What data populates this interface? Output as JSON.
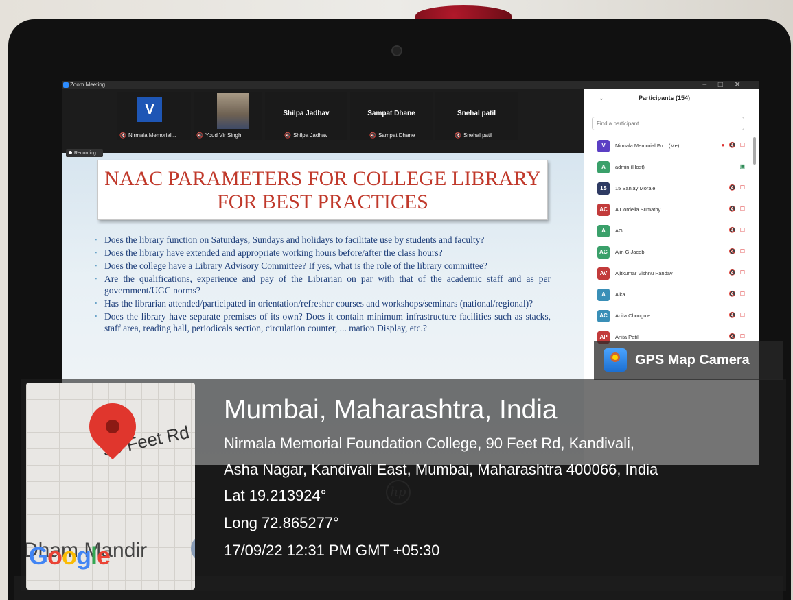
{
  "zoom": {
    "window_title": "Zoom Meeting",
    "recording": "Recording...",
    "video_tiles": [
      {
        "caption": "Nirmala Memorial...",
        "avatar_letter": "V"
      },
      {
        "caption": "Youd Vir Singh"
      },
      {
        "caption": "Shilpa Jadhav",
        "display_name": "Shilpa Jadhav"
      },
      {
        "caption": "Sampat Dhane",
        "display_name": "Sampat Dhane"
      },
      {
        "caption": "Snehal patil",
        "display_name": "Snehal patil"
      }
    ]
  },
  "slide": {
    "title_line1": "NAAC PARAMETERS FOR COLLEGE LIBRARY",
    "title_line2": "FOR BEST PRACTICES",
    "bullets": [
      "Does the library function on Saturdays, Sundays and holidays to facilitate use by students and faculty?",
      "Does the library have extended and appropriate working hours before/after the class hours?",
      "Does the college have a Library Advisory Committee? If yes, what is the role of the library committee?",
      "Are the qualifications, experience and pay of the Librarian on par with that of the academic staff and as per government/UGC norms?",
      "Has the librarian attended/participated in orientation/refresher courses and workshops/seminars (national/regional)?",
      "Does the library have separate premises of its own? Does it contain minimum infrastructure facilities such as stacks, staff area, reading hall, periodicals section, circulation counter, ... mation Display, etc.?"
    ]
  },
  "participants": {
    "title": "Participants (154)",
    "search_placeholder": "Find a participant",
    "list": [
      {
        "initials": "V",
        "name": "Nirmala Memorial Fo... (Me)",
        "color": "#5b3fc4"
      },
      {
        "initials": "A",
        "name": "admin (Host)",
        "color": "#3aa06a"
      },
      {
        "initials": "1S",
        "name": "15 Sanjay Morale",
        "color": "#2f3b63"
      },
      {
        "initials": "AC",
        "name": "A Cordelia Sumathy",
        "color": "#c23b3b"
      },
      {
        "initials": "A",
        "name": "AG",
        "color": "#3aa06a"
      },
      {
        "initials": "AG",
        "name": "Ajin G Jacob",
        "color": "#3aa06a"
      },
      {
        "initials": "AV",
        "name": "Ajitkumar Vishnu Pandav",
        "color": "#c23b3b"
      },
      {
        "initials": "A",
        "name": "Alka",
        "color": "#3a8fb7"
      },
      {
        "initials": "AC",
        "name": "Anita Chougule",
        "color": "#3a8fb7"
      },
      {
        "initials": "AP",
        "name": "Anita Patil",
        "color": "#c23b3b"
      }
    ]
  },
  "gps": {
    "app_name": "GPS Map Camera",
    "city": "Mumbai, Maharashtra, India",
    "address_line1": "Nirmala Memorial Foundation College, 90 Feet Rd, Kandivali,",
    "address_line2": "Asha Nagar, Kandivali East, Mumbai, Maharashtra 400066, India",
    "lat": "Lat 19.213924°",
    "long": "Long 72.865277°",
    "datetime": "17/09/22 12:31 PM GMT +05:30",
    "map_road": "90 Feet Rd",
    "map_place": "Dham Mandir"
  },
  "laptop": {
    "brand": "hp"
  }
}
